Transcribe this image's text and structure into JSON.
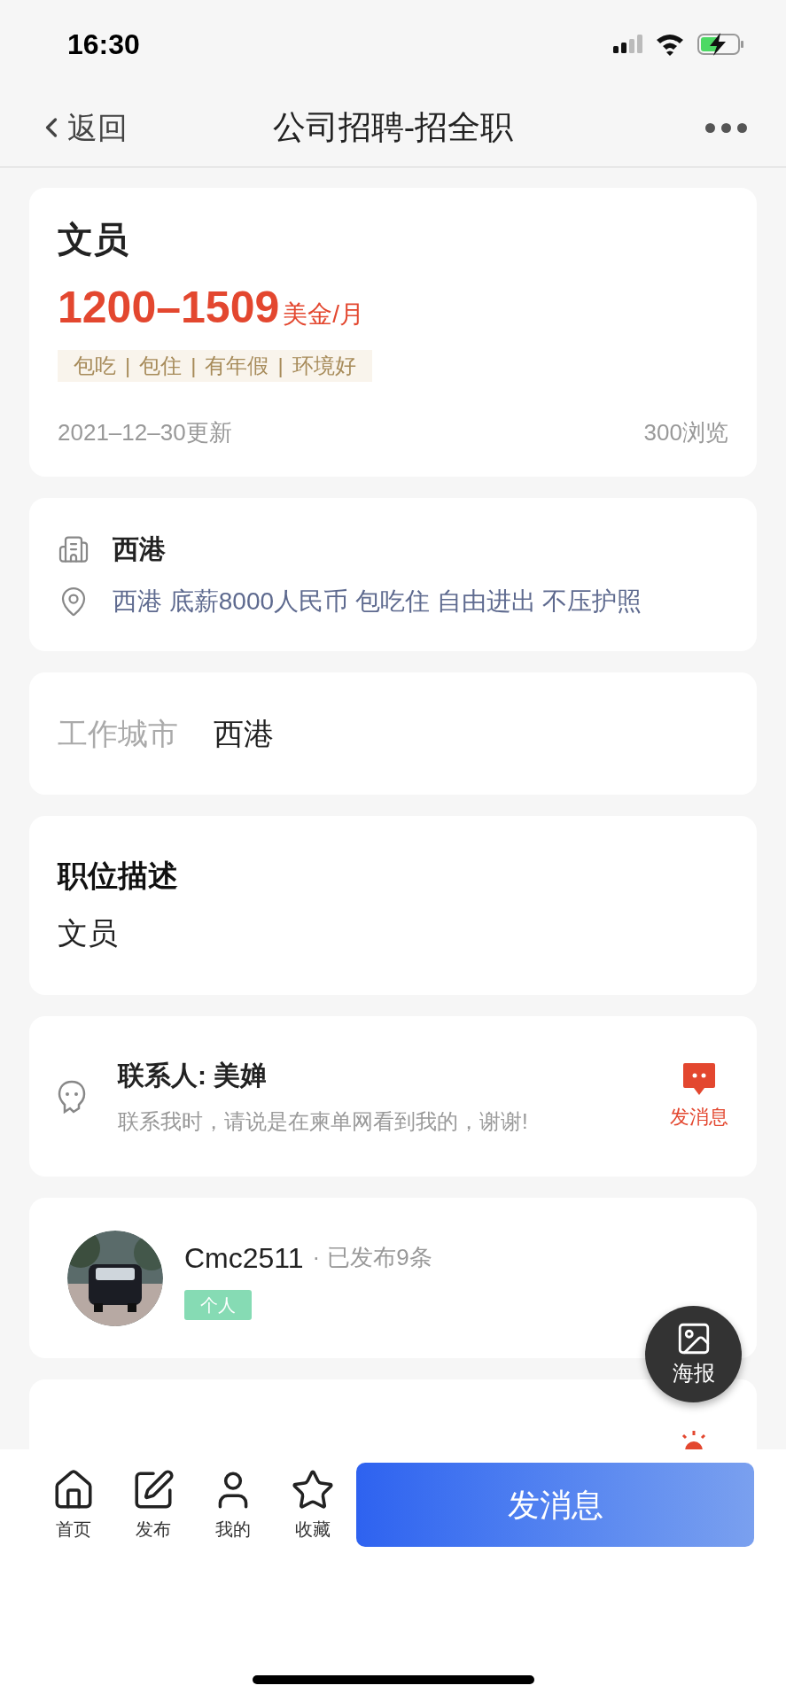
{
  "status_bar": {
    "time": "16:30"
  },
  "nav": {
    "back": "返回",
    "title": "公司招聘-招全职"
  },
  "job": {
    "title": "文员",
    "salary": "1200–1509",
    "unit": "美金/月",
    "tags": [
      {
        "label": "包吃"
      },
      {
        "separator": "|",
        "label": "包住"
      },
      {
        "separator": "|",
        "label": "有年假"
      },
      {
        "separator": "|",
        "label": "环境好"
      }
    ],
    "updated": "2021–12–30更新",
    "views": "300浏览"
  },
  "company": {
    "name": "西港",
    "address": "西港 底薪8000人民币 包吃住 自由进出 不压护照"
  },
  "city": {
    "label": "工作城市",
    "value": "西港"
  },
  "description": {
    "title": "职位描述",
    "text": "文员"
  },
  "contact": {
    "name": "联系人: 美婵",
    "note": "联系我时，请说是在柬单网看到我的，谢谢!",
    "action": "发消息"
  },
  "poster": {
    "username": "Cmc2511",
    "separator": "·",
    "posts": "已发布9条",
    "badge": "个人"
  },
  "float_button": {
    "label": "海报"
  },
  "tab_bar": {
    "items": [
      {
        "kind": "home",
        "label": "首页"
      },
      {
        "kind": "publish",
        "label": "发布"
      },
      {
        "kind": "mine",
        "label": "我的"
      },
      {
        "kind": "favorite",
        "label": "收藏"
      }
    ],
    "primary": "发消息"
  }
}
